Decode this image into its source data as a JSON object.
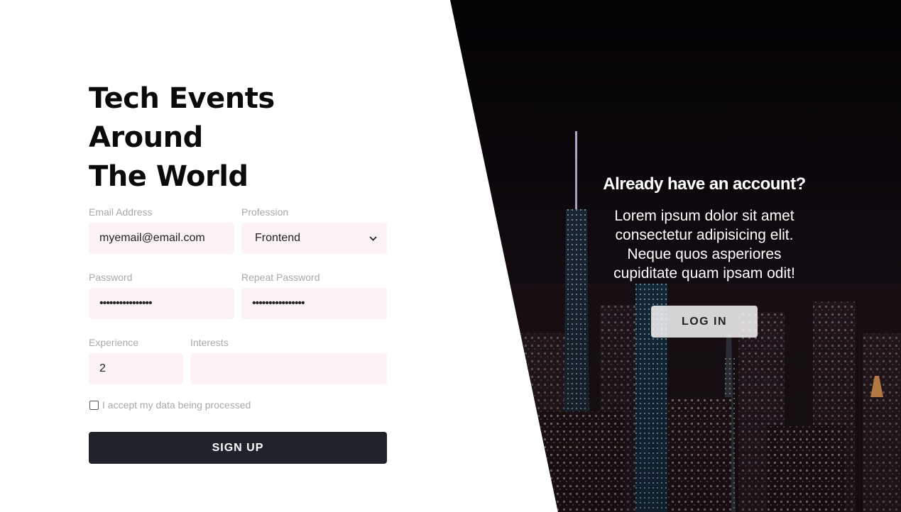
{
  "form": {
    "title_line1": "Tech Events Around",
    "title_line2": "The World",
    "email": {
      "label": "Email Address",
      "value": "myemail@email.com"
    },
    "profession": {
      "label": "Profession",
      "selected": "Frontend"
    },
    "password": {
      "label": "Password",
      "value": "••••••••••••••••"
    },
    "repeat_password": {
      "label": "Repeat Password",
      "value": "••••••••••••••••"
    },
    "experience": {
      "label": "Experience",
      "value": "2"
    },
    "interests": {
      "label": "Interests",
      "value": ""
    },
    "consent_label": "I accept my data being processed",
    "signup_label": "SIGN UP"
  },
  "login_panel": {
    "heading": "Already have an account?",
    "text": "Lorem ipsum dolor sit amet consectetur adipisicing elit. Neque quos asperiores cupiditate quam ipsam odit!",
    "login_label": "LOG IN"
  },
  "colors": {
    "field_background": "#fdf2f3",
    "button_dark": "#1f232b",
    "label_gray": "#a9a9a9"
  },
  "icons": {
    "profession_select": "chevron-down-icon",
    "consent": "checkbox-icon"
  }
}
